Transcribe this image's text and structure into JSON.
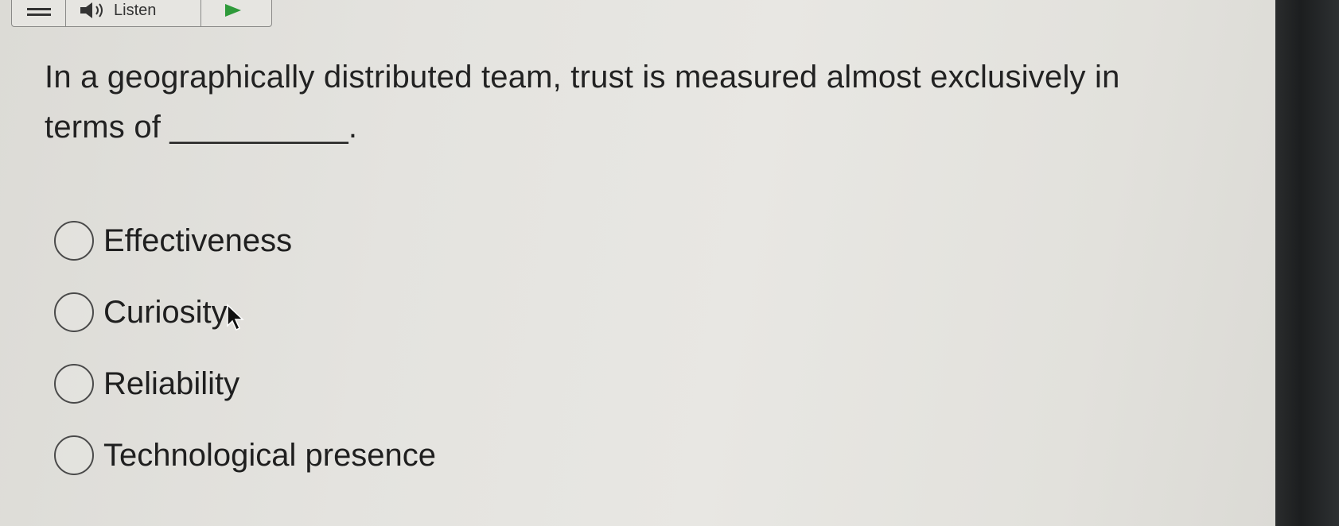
{
  "toolbar": {
    "listen_label": "Listen",
    "menu_icon": "menu-icon",
    "speaker_icon": "speaker-icon",
    "play_icon": "play-icon",
    "play_color": "#2e9a3a"
  },
  "question": {
    "text": "In a geographically distributed team, trust is measured almost exclusively in terms of __________."
  },
  "options": [
    {
      "label": "Effectiveness",
      "selected": false
    },
    {
      "label": "Curiosity",
      "selected": false
    },
    {
      "label": "Reliability",
      "selected": false
    },
    {
      "label": "Technological presence",
      "selected": false
    }
  ]
}
